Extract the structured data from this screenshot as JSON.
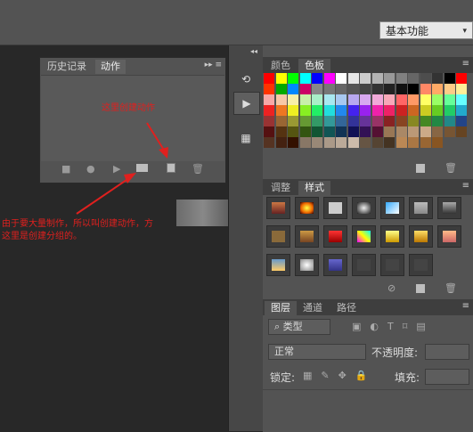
{
  "workspace": {
    "label": "基本功能",
    "chevron": "▾"
  },
  "history_panel": {
    "tabs": [
      "历史记录",
      "动作"
    ],
    "active_tab": "动作",
    "menu_icon": "▸▸ ≡",
    "footer_icons": [
      "stop-icon",
      "record-icon",
      "play-icon",
      "folder-icon",
      "new-action-icon",
      "delete-icon"
    ]
  },
  "annotations": {
    "create_action_note": "这里创建动作",
    "bottom_note_line1": "由于要大量制作，所以叫创建动作，方",
    "bottom_note_line2": "这里是创建分组的。"
  },
  "collapsed_column": {
    "buttons": [
      "history-icon",
      "play-icon",
      "actions-icon"
    ],
    "collapse_arrows": "◂◂"
  },
  "swatches_panel": {
    "tabs": [
      "颜色",
      "色板"
    ],
    "active_tab": "色板"
  },
  "styles_panel": {
    "tabs": [
      "调整",
      "样式"
    ],
    "active_tab": "样式"
  },
  "layers_panel": {
    "tabs": [
      "图层",
      "通道",
      "路径"
    ],
    "active_tab": "图层",
    "kind_filter": "类型",
    "blend_mode": "正常",
    "opacity_label": "不透明度:",
    "lock_label": "锁定:",
    "fill_label": "填充:"
  },
  "colors": {
    "accent_red": "#e0201e",
    "panel": "#535353",
    "canvas": "#282828"
  }
}
